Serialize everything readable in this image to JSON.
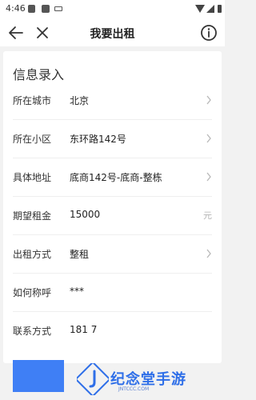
{
  "status_bar": {
    "time": "4:46"
  },
  "nav": {
    "title": "我要出租"
  },
  "form": {
    "heading": "信息录入",
    "rows": [
      {
        "label": "所在城市",
        "value": "北京",
        "chevron": true
      },
      {
        "label": "所在小区",
        "value": "东环路142号",
        "chevron": true
      },
      {
        "label": "具体地址",
        "value": "底商142号-底商-整栋",
        "chevron": true
      },
      {
        "label": "期望租金",
        "value": "15000",
        "unit": "元",
        "chevron": false
      },
      {
        "label": "出租方式",
        "value": "整租",
        "chevron": true
      },
      {
        "label": "如何称呼",
        "value": "***",
        "chevron": false
      },
      {
        "label": "联系方式",
        "value": "181        7",
        "chevron": false
      }
    ]
  },
  "watermark": {
    "text": "纪念堂手游",
    "url": "JNTCCC.COM"
  },
  "colors": {
    "accent": "#3f7ff5",
    "watermark": "#2f6fe8"
  }
}
